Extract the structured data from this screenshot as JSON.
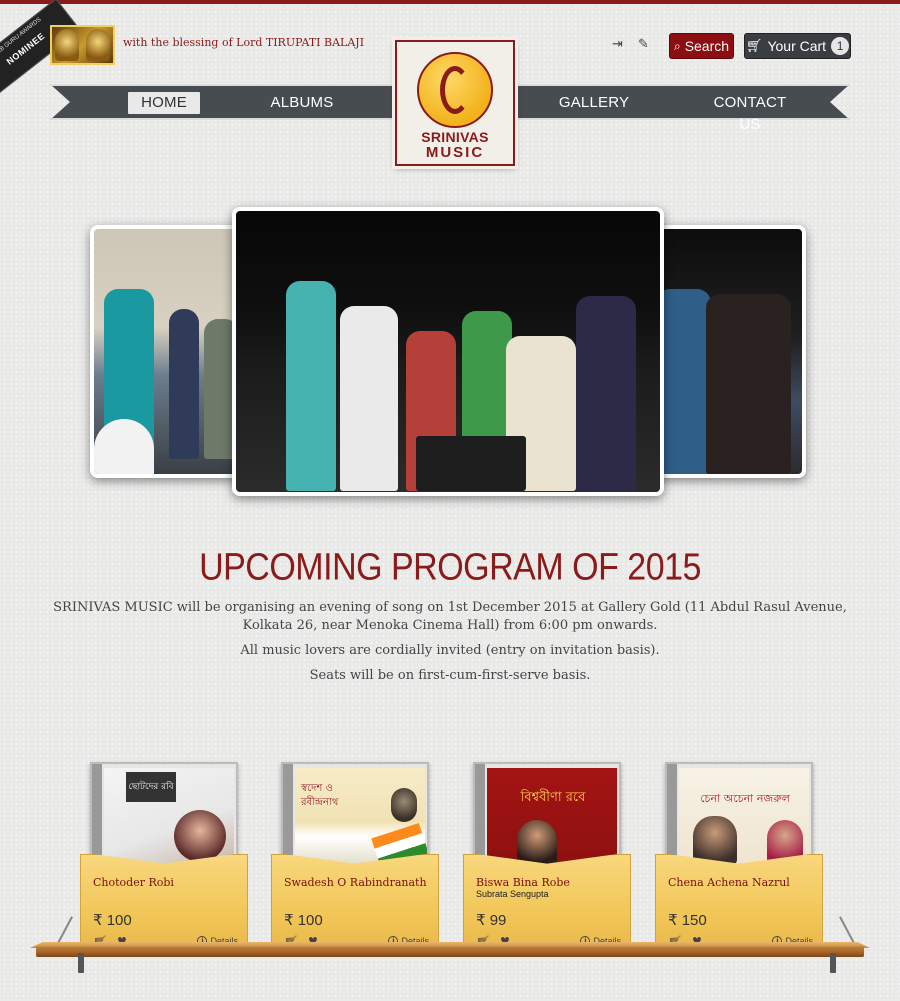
{
  "nominee": {
    "small": "WEB GURU AWARDS",
    "label": "NOMINEE"
  },
  "blessing": "with the blessing of Lord TIRUPATI BALAJI",
  "header": {
    "search_label": "Search",
    "cart_label": "Your Cart",
    "cart_count": "1",
    "icons": [
      "login-icon",
      "register-icon"
    ]
  },
  "nav": {
    "items": [
      {
        "label": "HOME",
        "active": true
      },
      {
        "label": "ALBUMS"
      },
      {
        "label": "GALLERY"
      },
      {
        "label": "CONTACT US"
      }
    ]
  },
  "logo": {
    "line1": "SRINIVAS",
    "line2": "MUSIC"
  },
  "program": {
    "title": "UPCOMING PROGRAM OF 2015",
    "paragraphs": [
      "SRINIVAS MUSIC will be organising an evening of song on 1st December 2015 at Gallery Gold (11 Abdul Rasul Avenue, Kolkata 26, near Menoka Cinema Hall) from 6:00 pm onwards.",
      "All music lovers are cordially invited (entry on invitation basis).",
      "Seats will be on first-cum-first-serve basis."
    ]
  },
  "products": [
    {
      "title": "Chotoder Robi",
      "subtitle": "",
      "price": "₹ 100",
      "details": "Details",
      "cover_art": "ছোটদের রবি"
    },
    {
      "title": "Swadesh O Rabindranath",
      "subtitle": "",
      "price": "₹ 100",
      "details": "Details",
      "cover_art": "স্বদেশ ও রবীন্দ্রনাথ"
    },
    {
      "title": "Biswa Bina Robe",
      "subtitle": "Subrata Sengupta",
      "price": "₹ 99",
      "details": "Details",
      "cover_art": "বিশ্ববীণা রবে"
    },
    {
      "title": "Chena Achena Nazrul",
      "subtitle": "",
      "price": "₹ 150",
      "details": "Details",
      "cover_art": "চেনা অচেনা নজরুল"
    }
  ],
  "colors": {
    "accent": "#8b1a1a",
    "nav": "#474c51",
    "pocket": "#f2c759"
  }
}
